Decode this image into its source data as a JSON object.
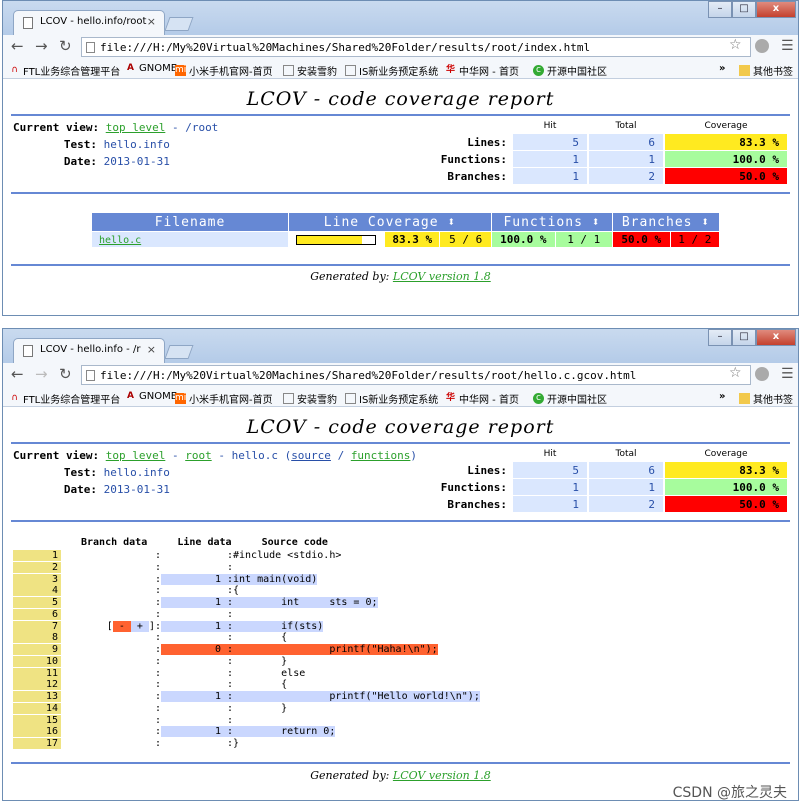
{
  "colors": {
    "hi": "#a7fc9d",
    "med": "#ffea20",
    "lo": "#ff0000",
    "header_blue": "#6688d4"
  },
  "browser": {
    "bookmarks": [
      {
        "label": "FTL业务综合管理平台",
        "icon": "ftl-icon"
      },
      {
        "label": "GNOME",
        "icon": "gnome-icon"
      },
      {
        "label": "小米手机官网-首页",
        "icon": "mi-icon"
      },
      {
        "label": "安装雪豹",
        "icon": "page-icon"
      },
      {
        "label": "IS新业务预定系统",
        "icon": "page-icon"
      },
      {
        "label": "中华网 - 首页",
        "icon": "china-icon"
      },
      {
        "label": "开源中国社区",
        "icon": "oschina-icon"
      }
    ],
    "more": "»",
    "other_bookmarks": "其他书签",
    "window_buttons": [
      "–",
      "□",
      "x"
    ]
  },
  "window1": {
    "tab_title": "LCOV - hello.info/root",
    "url": "file:///H:/My%20Virtual%20Machines/Shared%20Folder/results/root/index.html",
    "page_title": "LCOV - code coverage report",
    "current_view_label": "Current view:",
    "top_level": "top level",
    "path": " - /root",
    "test_label": "Test:",
    "test_value": "hello.info",
    "date_label": "Date:",
    "date_value": "2013-01-31",
    "col_hit": "Hit",
    "col_total": "Total",
    "col_coverage": "Coverage",
    "lines_label": "Lines:",
    "lines_hit": "5",
    "lines_total": "6",
    "lines_pct": "83.3 %",
    "func_label": "Functions:",
    "func_hit": "1",
    "func_total": "1",
    "func_pct": "100.0 %",
    "br_label": "Branches:",
    "br_hit": "1",
    "br_total": "2",
    "br_pct": "50.0 %",
    "table_headers": [
      "Filename",
      "Line Coverage ⬍",
      "Functions ⬍",
      "Branches ⬍"
    ],
    "file": {
      "name": "hello.c",
      "line_coverage_fraction": 0.833,
      "line_pct": "83.3 %",
      "line_count": "5 / 6",
      "func_pct": "100.0 %",
      "func_count": "1 / 1",
      "br_pct": "50.0 %",
      "br_count": "1 / 2"
    },
    "generated_by": "Generated by:",
    "lcov_version": "LCOV version 1.8"
  },
  "window2": {
    "tab_title": "LCOV - hello.info - /r",
    "url": "file:///H:/My%20Virtual%20Machines/Shared%20Folder/results/root/hello.c.gcov.html",
    "page_title": "LCOV - code coverage report",
    "current_view_label": "Current view:",
    "top_level": "top level",
    "root": "root",
    "file": "hello.c",
    "source": "source",
    "functions": "functions",
    "test_label": "Test:",
    "test_value": "hello.info",
    "date_label": "Date:",
    "date_value": "2013-01-31",
    "col_hit": "Hit",
    "col_total": "Total",
    "col_coverage": "Coverage",
    "lines_label": "Lines:",
    "lines_hit": "5",
    "lines_total": "6",
    "lines_pct": "83.3 %",
    "func_label": "Functions:",
    "func_hit": "1",
    "func_total": "1",
    "func_pct": "100.0 %",
    "br_label": "Branches:",
    "br_hit": "1",
    "br_total": "2",
    "br_pct": "50.0 %",
    "src_headers": {
      "branch": "Branch data",
      "line": "Line data",
      "code": "Source code"
    },
    "source_lines": [
      {
        "n": "1",
        "br": ":",
        "hit": ":",
        "code": "#include <stdio.h>",
        "state": ""
      },
      {
        "n": "2",
        "br": ":",
        "hit": ":",
        "code": "",
        "state": ""
      },
      {
        "n": "3",
        "br": ":",
        "hit": "1 :",
        "code": "int main(void)",
        "state": "hit"
      },
      {
        "n": "4",
        "br": ":",
        "hit": ":",
        "code": "{",
        "state": ""
      },
      {
        "n": "5",
        "br": ":",
        "hit": "1 :",
        "code": "        int     sts = 0;",
        "state": "hit"
      },
      {
        "n": "6",
        "br": ":",
        "hit": ":",
        "code": "",
        "state": ""
      },
      {
        "n": "7",
        "br": "branch",
        "hit": "1 :",
        "code": "        if(sts)",
        "state": "hit"
      },
      {
        "n": "8",
        "br": ":",
        "hit": ":",
        "code": "        {",
        "state": ""
      },
      {
        "n": "9",
        "br": ":",
        "hit": "0 :",
        "code": "                printf(\"Haha!\\n\");",
        "state": "miss"
      },
      {
        "n": "10",
        "br": ":",
        "hit": ":",
        "code": "        }",
        "state": ""
      },
      {
        "n": "11",
        "br": ":",
        "hit": ":",
        "code": "        else",
        "state": ""
      },
      {
        "n": "12",
        "br": ":",
        "hit": ":",
        "code": "        {",
        "state": ""
      },
      {
        "n": "13",
        "br": ":",
        "hit": "1 :",
        "code": "                printf(\"Hello world!\\n\");",
        "state": "hit"
      },
      {
        "n": "14",
        "br": ":",
        "hit": ":",
        "code": "        }",
        "state": ""
      },
      {
        "n": "15",
        "br": ":",
        "hit": ":",
        "code": "",
        "state": ""
      },
      {
        "n": "16",
        "br": ":",
        "hit": "1 :",
        "code": "        return 0;",
        "state": "hit"
      },
      {
        "n": "17",
        "br": ":",
        "hit": ":",
        "code": "}",
        "state": ""
      }
    ],
    "branch_open": "[",
    "branch_minus": " - ",
    "branch_plus": " + ",
    "branch_close": "]:",
    "generated_by": "Generated by:",
    "lcov_version": "LCOV version 1.8"
  },
  "watermark": "CSDN @旅之灵夫"
}
